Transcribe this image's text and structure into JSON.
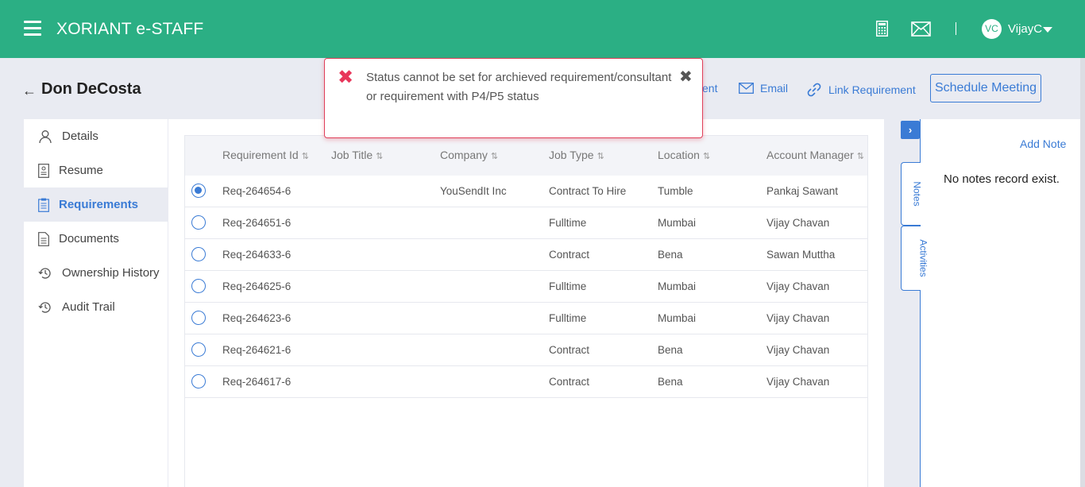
{
  "app": {
    "brand": "XORIANT e-STAFF"
  },
  "topbar": {
    "avatar_initials": "VC",
    "username": "VijayC",
    "icons": [
      "calculator-icon",
      "mail-icon"
    ]
  },
  "header": {
    "name": "Don DeCosta",
    "links": {
      "partial_label": "ent",
      "email_label": "Email",
      "link_requirement_label": "Link Requirement"
    },
    "schedule_meeting_label": "Schedule Meeting"
  },
  "nav": {
    "items": [
      {
        "label": "Details",
        "icon": "user-icon"
      },
      {
        "label": "Resume",
        "icon": "resume-icon"
      },
      {
        "label": "Requirements",
        "icon": "clipboard-icon",
        "active": true
      },
      {
        "label": "Documents",
        "icon": "document-icon"
      },
      {
        "label": "Ownership History",
        "icon": "history-icon"
      },
      {
        "label": "Audit Trail",
        "icon": "history-icon"
      }
    ]
  },
  "table": {
    "columns": [
      "Requirement Id",
      "Job Title",
      "Company",
      "Job Type",
      "Location",
      "Account Manager"
    ],
    "rows": [
      {
        "selected": true,
        "req_id": "Req-264654-6",
        "job_title": "",
        "company": "YouSendIt Inc",
        "job_type": "Contract To Hire",
        "location": "Tumble",
        "manager": "Pankaj Sawant"
      },
      {
        "selected": false,
        "req_id": "Req-264651-6",
        "job_title": "",
        "company": "",
        "job_type": "Fulltime",
        "location": "Mumbai",
        "manager": "Vijay Chavan"
      },
      {
        "selected": false,
        "req_id": "Req-264633-6",
        "job_title": "",
        "company": "",
        "job_type": "Contract",
        "location": "Bena",
        "manager": "Sawan Muttha"
      },
      {
        "selected": false,
        "req_id": "Req-264625-6",
        "job_title": "",
        "company": "",
        "job_type": "Fulltime",
        "location": "Mumbai",
        "manager": "Vijay Chavan"
      },
      {
        "selected": false,
        "req_id": "Req-264623-6",
        "job_title": "",
        "company": "",
        "job_type": "Fulltime",
        "location": "Mumbai",
        "manager": "Vijay Chavan"
      },
      {
        "selected": false,
        "req_id": "Req-264621-6",
        "job_title": "",
        "company": "",
        "job_type": "Contract",
        "location": "Bena",
        "manager": "Vijay Chavan"
      },
      {
        "selected": false,
        "req_id": "Req-264617-6",
        "job_title": "",
        "company": "",
        "job_type": "Contract",
        "location": "Bena",
        "manager": "Vijay Chavan"
      }
    ]
  },
  "notes": {
    "tabs": [
      "Notes",
      "Activities"
    ],
    "add_note_label": "Add Note",
    "empty_text": "No notes record exist."
  },
  "toast": {
    "message": "Status cannot be set for archieved requirement/consultant or requirement with P4/P5 status",
    "close_glyph": "✖"
  },
  "colors": {
    "brand": "#2baf84",
    "accent": "#3a7bd5",
    "error": "#e8365a"
  }
}
